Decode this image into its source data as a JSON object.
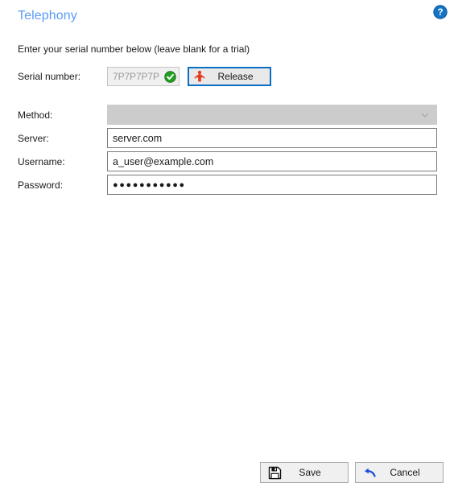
{
  "window": {
    "title": "Telephony"
  },
  "help": {
    "icon": "help-circle-icon",
    "tooltip": "?"
  },
  "instruction": {
    "text": "Enter your serial number below (leave blank for a trial)"
  },
  "serial": {
    "label": "Serial number:",
    "value": "7P7P7P7P",
    "status_icon": "green-check-icon",
    "release_button": {
      "label": "Release",
      "icon": "red-person-icon",
      "focused": true
    }
  },
  "fields": [
    {
      "name": "method",
      "label": "Method:",
      "type": "select",
      "value": "",
      "placeholder": "",
      "disabled": true,
      "icon": "chevron-down-icon"
    },
    {
      "name": "server",
      "label": "Server:",
      "type": "text",
      "value": "server.com",
      "placeholder": "",
      "disabled": false
    },
    {
      "name": "username",
      "label": "Username:",
      "type": "text",
      "value": "a_user@example.com",
      "placeholder": "",
      "disabled": false
    },
    {
      "name": "password",
      "label": "Password:",
      "type": "password",
      "value": "●●●●●●●●●●●",
      "placeholder": "",
      "disabled": false
    }
  ],
  "footer": {
    "save_label": "Save",
    "save_icon": "floppy-disk-icon",
    "cancel_label": "Cancel",
    "cancel_icon": "undo-arrow-icon"
  },
  "colors": {
    "title_blue": "#5b9bf5",
    "focus_blue": "#0a6ec4",
    "help_blue": "#1572c4",
    "status_green": "#23a024",
    "release_red": "#e23a1e",
    "cancel_blue": "#1b4fd8",
    "field_border": "#7a7a7a",
    "disabled_bg": "#cccccc",
    "button_bg": "#f0f0f0"
  }
}
